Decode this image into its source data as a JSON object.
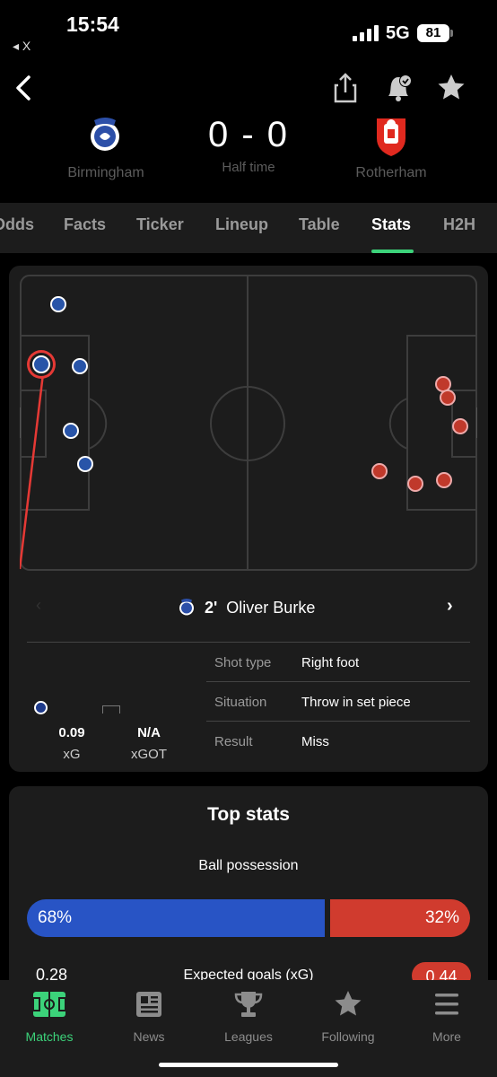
{
  "status_bar": {
    "time": "15:54",
    "back_app": "◂ X",
    "network": "5G",
    "battery": "81"
  },
  "match": {
    "home_team": "Birmingham",
    "away_team": "Rotherham",
    "score": "0 - 0",
    "status": "Half time",
    "home_color": "#2854c5",
    "away_color": "#d03b2e"
  },
  "tabs": [
    {
      "label": "Odds"
    },
    {
      "label": "Facts"
    },
    {
      "label": "Ticker"
    },
    {
      "label": "Lineup"
    },
    {
      "label": "Table"
    },
    {
      "label": "Stats",
      "active": true
    },
    {
      "label": "H2H"
    }
  ],
  "shot_detail": {
    "minute": "2'",
    "player": "Oliver Burke",
    "xg_value": "0.09",
    "xg_label": "xG",
    "xgot_value": "N/A",
    "xgot_label": "xGOT",
    "rows": [
      {
        "label": "Shot type",
        "value": "Right foot"
      },
      {
        "label": "Situation",
        "value": "Throw in set piece"
      },
      {
        "label": "Result",
        "value": "Miss"
      }
    ]
  },
  "top_stats": {
    "title": "Top stats",
    "possession_label": "Ball possession",
    "possession_home_pct": 68,
    "possession_away_pct": 32,
    "possession_home": "68%",
    "possession_away": "32%",
    "xg_label": "Expected goals (xG)",
    "xg_home": "0.28",
    "xg_away": "0.44"
  },
  "bottom_nav": [
    {
      "label": "Matches",
      "icon": "pitch-icon",
      "active": true
    },
    {
      "label": "News",
      "icon": "newspaper-icon"
    },
    {
      "label": "Leagues",
      "icon": "trophy-icon"
    },
    {
      "label": "Following",
      "icon": "star-icon"
    },
    {
      "label": "More",
      "icon": "menu-icon"
    }
  ],
  "accent_color": "#3cd27a"
}
